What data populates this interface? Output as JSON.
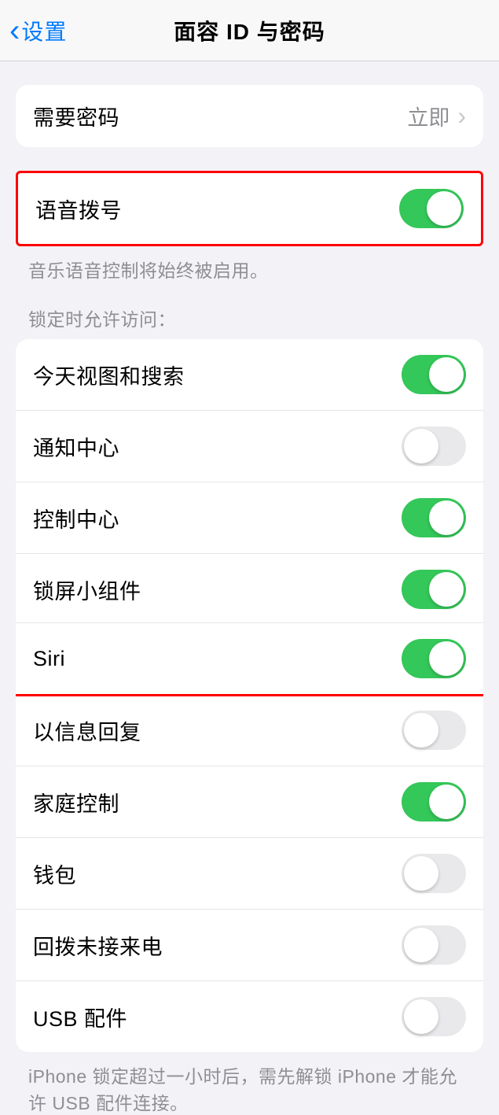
{
  "nav": {
    "back_label": "设置",
    "title": "面容 ID 与密码"
  },
  "require_passcode": {
    "label": "需要密码",
    "value": "立即"
  },
  "voice_dial": {
    "label": "语音拨号",
    "footer": "音乐语音控制将始终被启用。",
    "on": true
  },
  "locked_access": {
    "header": "锁定时允许访问：",
    "items": [
      {
        "label": "今天视图和搜索",
        "on": true,
        "highlight": false
      },
      {
        "label": "通知中心",
        "on": false,
        "highlight": false
      },
      {
        "label": "控制中心",
        "on": true,
        "highlight": false
      },
      {
        "label": "锁屏小组件",
        "on": true,
        "highlight": false
      },
      {
        "label": "Siri",
        "on": true,
        "highlight": true
      },
      {
        "label": "以信息回复",
        "on": false,
        "highlight": false
      },
      {
        "label": "家庭控制",
        "on": true,
        "highlight": false
      },
      {
        "label": "钱包",
        "on": false,
        "highlight": false
      },
      {
        "label": "回拨未接来电",
        "on": false,
        "highlight": false
      },
      {
        "label": "USB 配件",
        "on": false,
        "highlight": false
      }
    ],
    "footer": "iPhone 锁定超过一小时后，需先解锁 iPhone 才能允许 USB 配件连接。"
  }
}
